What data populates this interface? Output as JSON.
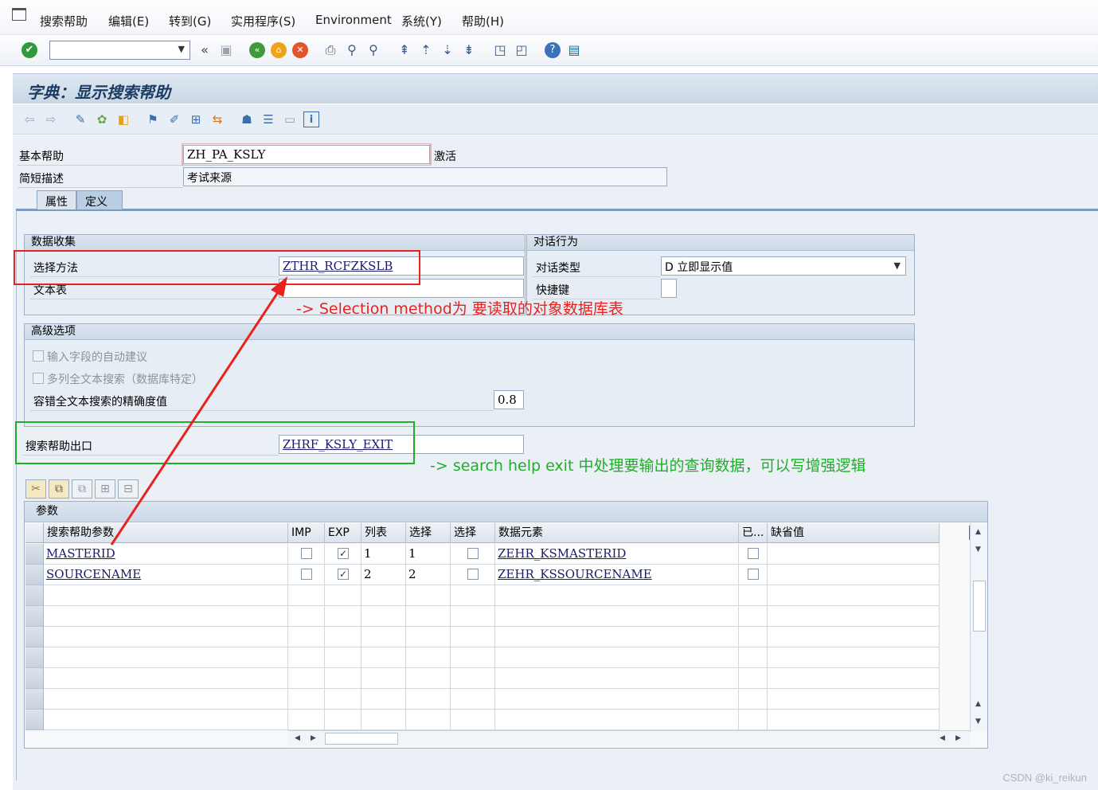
{
  "menu": {
    "items": [
      "搜索帮助",
      "编辑(E)",
      "转到(G)",
      "实用程序(S)",
      "Environment",
      "系统(Y)",
      "帮助(H)"
    ]
  },
  "toolbar": {
    "command_field": "",
    "icons": [
      "check-icon",
      "back-double-icon",
      "save-icon",
      "back-icon",
      "exit-icon",
      "cancel-icon",
      "print-icon",
      "find-icon",
      "find-next-icon",
      "first-page-icon",
      "prev-page-icon",
      "next-page-icon",
      "last-page-icon",
      "new-session-icon",
      "shortcut-icon",
      "help-icon",
      "layout-icon"
    ]
  },
  "title": "字典：显示搜索帮助",
  "header": {
    "basic_help_label": "基本帮助",
    "basic_help_value": "ZH_PA_KSLY",
    "status": "激活",
    "short_desc_label": "简短描述",
    "short_desc_value": "考试来源"
  },
  "tabs": [
    "属性",
    "定义"
  ],
  "data_collection": {
    "title": "数据收集",
    "selection_method_label": "选择方法",
    "selection_method_value": "ZTHR_RCFZKSLB",
    "text_table_label": "文本表",
    "text_table_value": ""
  },
  "dialog": {
    "title": "对话行为",
    "dialog_type_label": "对话类型",
    "dialog_type_value": "D 立即显示值",
    "hotkey_label": "快捷键",
    "hotkey_value": ""
  },
  "advanced": {
    "title": "高级选项",
    "option1": "输入字段的自动建议",
    "option2": "多列全文本搜索（数据库特定）",
    "accuracy_label": "容错全文本搜索的精确度值",
    "accuracy_value": "0.8"
  },
  "exit": {
    "label": "搜索帮助出口",
    "value": "ZHRF_KSLY_EXIT"
  },
  "annotations": {
    "red_note": "-> Selection method为 要读取的对象数据库表",
    "green_note": "-> search help exit 中处理要输出的查询数据，可以写增强逻辑"
  },
  "params": {
    "title": "参数",
    "columns": [
      "搜索帮助参数",
      "IMP",
      "EXP",
      "列表",
      "选择",
      "选择",
      "数据元素",
      "已...",
      "缺省值"
    ],
    "rows": [
      {
        "param": "MASTERID",
        "imp": false,
        "exp": true,
        "list": "1",
        "sel": "1",
        "sel2": false,
        "element": "ZEHR_KSMASTERID",
        "mod": false,
        "default": ""
      },
      {
        "param": "SOURCENAME",
        "imp": false,
        "exp": true,
        "list": "2",
        "sel": "2",
        "sel2": false,
        "element": "ZEHR_KSSOURCENAME",
        "mod": false,
        "default": ""
      }
    ]
  },
  "watermark": "CSDN @ki_reikun",
  "colors": {
    "annotation_red": "#e8231f",
    "annotation_green": "#20ad29",
    "title_blue": "#1c3d63"
  }
}
